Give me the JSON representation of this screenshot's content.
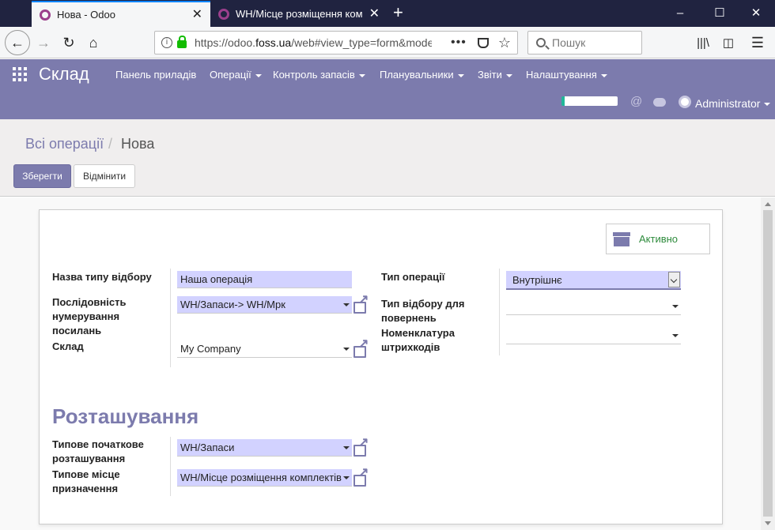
{
  "browser": {
    "tabs": [
      {
        "title": "Нова - Odoo",
        "active": true
      },
      {
        "title": "WH/Місце розміщення комплектів",
        "active": false
      }
    ],
    "url_prefix": "https://odoo.",
    "url_domain": "foss.ua",
    "url_rest": "/web#view_type=form&model=stock.picking.type",
    "search_placeholder": "Пошук"
  },
  "app": {
    "name": "Склад",
    "menu": [
      "Панель приладів",
      "Операції",
      "Контроль запасів",
      "Планувальники",
      "Звіти",
      "Налаштування"
    ],
    "user": "Administrator"
  },
  "breadcrumb": {
    "parent": "Всі операції",
    "separator": "/",
    "current": "Нова"
  },
  "buttons": {
    "save": "Зберегти",
    "discard": "Відмінити"
  },
  "form": {
    "active_label": "Активно",
    "left": [
      {
        "label": "Назва типу відбору",
        "value": "Наша операція"
      },
      {
        "label": "Послідовність нумерування посилань",
        "value": "WH/Запаси-> WH/Мрк"
      },
      {
        "label": "Склад",
        "value": "My Company"
      }
    ],
    "right": [
      {
        "label": "Тип операції",
        "value": "Внутрішнє"
      },
      {
        "label": "Тип відбору для повернень",
        "value": ""
      },
      {
        "label": "Номенклатура штрихкодів",
        "value": ""
      }
    ],
    "section_title": "Розташування",
    "locations": [
      {
        "label": "Типове початкове розташування",
        "value": "WH/Запаси"
      },
      {
        "label": "Типове місце призначення",
        "value": "WH/Місце розміщення комплектів"
      }
    ]
  },
  "colors": {
    "brand": "#7c7bad",
    "required_field": "#d2d2ff",
    "active_green": "#2e8b3c"
  }
}
